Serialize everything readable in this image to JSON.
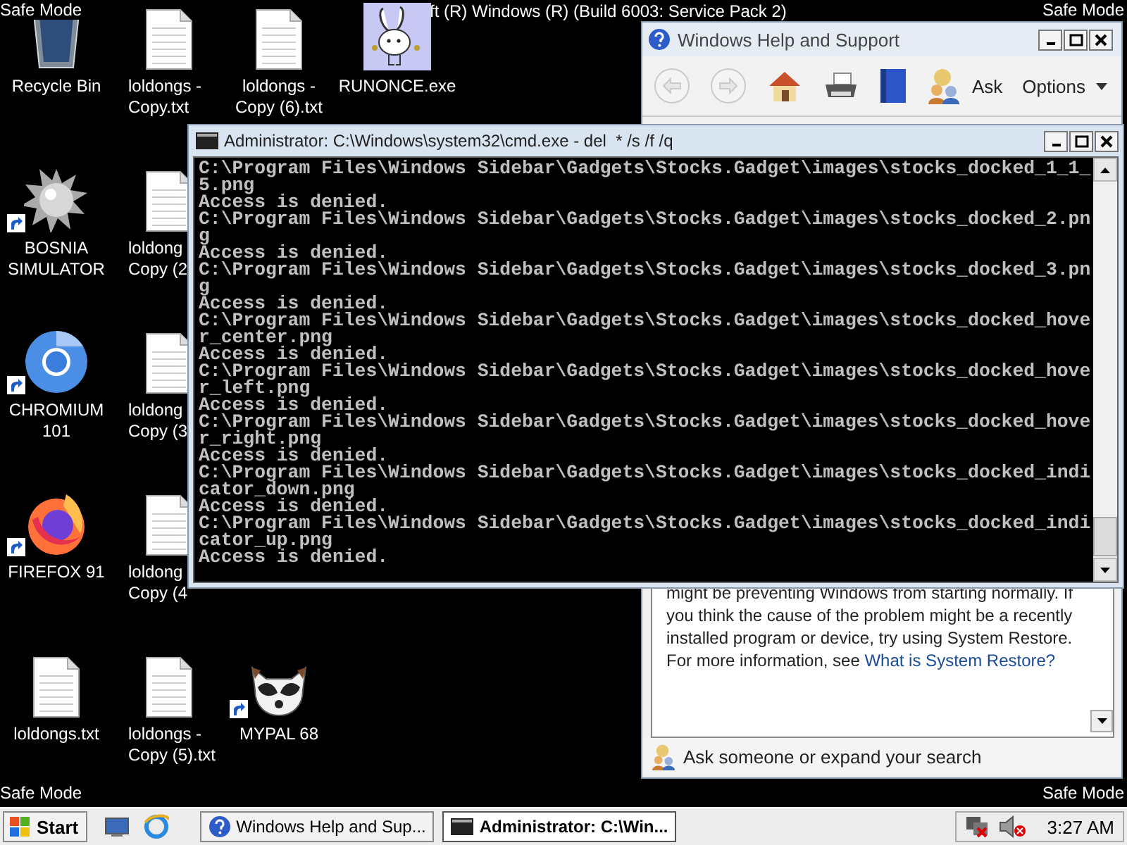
{
  "desktop": {
    "corner_labels": [
      "Safe Mode",
      "Safe Mode",
      "Safe Mode",
      "Safe Mode"
    ],
    "build_text": "ft (R) Windows (R) (Build 6003: Service Pack 2)",
    "icon_columns": [
      [
        {
          "kind": "recycle-bin",
          "label": [
            "Recycle Bin"
          ],
          "shortcut": false
        },
        {
          "kind": "spiked-ball",
          "label": [
            "BOSNIA",
            "SIMULATOR"
          ],
          "shortcut": true
        },
        {
          "kind": "chromium",
          "label": [
            "CHROMIUM",
            "101"
          ],
          "shortcut": true
        },
        {
          "kind": "firefox",
          "label": [
            "FIREFOX 91"
          ],
          "shortcut": true
        },
        {
          "kind": "text-file",
          "label": [
            "loldongs.txt"
          ],
          "shortcut": false
        }
      ],
      [
        {
          "kind": "text-file",
          "label": [
            "loldongs -",
            "Copy.txt"
          ],
          "shortcut": false
        },
        {
          "kind": "text-file",
          "label": [
            "loldong",
            "Copy (2"
          ],
          "shortcut": false
        },
        {
          "kind": "text-file",
          "label": [
            "loldong",
            "Copy (3"
          ],
          "shortcut": false
        },
        {
          "kind": "text-file",
          "label": [
            "loldong",
            "Copy (4"
          ],
          "shortcut": false
        },
        {
          "kind": "text-file",
          "label": [
            "loldongs -",
            "Copy (5).txt"
          ],
          "shortcut": false
        }
      ],
      [
        {
          "kind": "text-file",
          "label": [
            "loldongs -",
            "Copy (6).txt"
          ],
          "shortcut": false
        },
        null,
        null,
        null,
        {
          "kind": "raccoon",
          "label": [
            "MYPAL 68"
          ],
          "shortcut": true
        }
      ],
      [
        {
          "kind": "bunny",
          "label": [
            "RUNONCE.exe"
          ],
          "shortcut": false
        }
      ]
    ]
  },
  "help_window": {
    "title": "Windows Help and Support",
    "toolbar": [
      {
        "kind": "back",
        "disabled": true
      },
      {
        "kind": "forward",
        "disabled": true
      },
      {
        "kind": "home",
        "disabled": false
      },
      {
        "kind": "print",
        "disabled": false
      },
      {
        "kind": "book",
        "disabled": false
      },
      {
        "kind": "ask",
        "label": "Ask",
        "disabled": false
      },
      {
        "kind": "options",
        "label": "Options",
        "disabled": false
      }
    ],
    "body_text": "might be preventing Windows from starting normally. If you think the cause of the problem might be a recently installed program or device, try using System Restore. For more information, see ",
    "body_link": "What is System Restore?",
    "footer": "Ask someone or expand your search"
  },
  "cmd_window": {
    "title": "Administrator: C:\\Windows\\system32\\cmd.exe - del  * /s /f /q",
    "lines": [
      "C:\\Program Files\\Windows Sidebar\\Gadgets\\Stocks.Gadget\\images\\stocks_docked_1_1_",
      "5.png",
      "Access is denied.",
      "C:\\Program Files\\Windows Sidebar\\Gadgets\\Stocks.Gadget\\images\\stocks_docked_2.pn",
      "g",
      "Access is denied.",
      "C:\\Program Files\\Windows Sidebar\\Gadgets\\Stocks.Gadget\\images\\stocks_docked_3.pn",
      "g",
      "Access is denied.",
      "C:\\Program Files\\Windows Sidebar\\Gadgets\\Stocks.Gadget\\images\\stocks_docked_hove",
      "r_center.png",
      "Access is denied.",
      "C:\\Program Files\\Windows Sidebar\\Gadgets\\Stocks.Gadget\\images\\stocks_docked_hove",
      "r_left.png",
      "Access is denied.",
      "C:\\Program Files\\Windows Sidebar\\Gadgets\\Stocks.Gadget\\images\\stocks_docked_hove",
      "r_right.png",
      "Access is denied.",
      "C:\\Program Files\\Windows Sidebar\\Gadgets\\Stocks.Gadget\\images\\stocks_docked_indi",
      "cator_down.png",
      "Access is denied.",
      "C:\\Program Files\\Windows Sidebar\\Gadgets\\Stocks.Gadget\\images\\stocks_docked_indi",
      "cator_up.png",
      "Access is denied."
    ]
  },
  "taskbar": {
    "start": "Start",
    "quick_launch": [
      {
        "kind": "desktop"
      },
      {
        "kind": "browser"
      }
    ],
    "tasks": [
      {
        "kind": "help",
        "label": "Windows Help and Sup...",
        "selected": false
      },
      {
        "kind": "console",
        "label": "Administrator: C:\\Win...",
        "selected": true
      }
    ],
    "tray": [
      {
        "kind": "network-error"
      },
      {
        "kind": "sound-muted"
      }
    ],
    "clock": "3:27 AM"
  }
}
